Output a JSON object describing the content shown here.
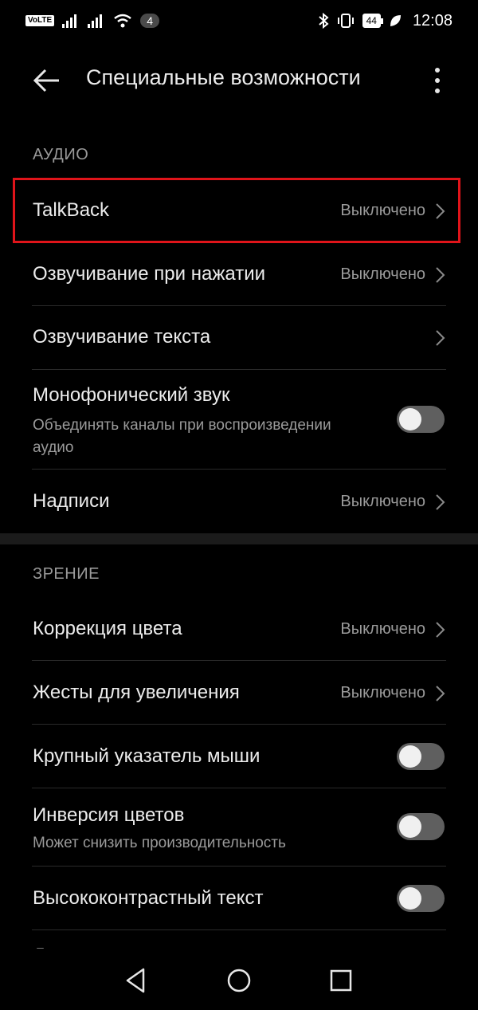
{
  "status_bar": {
    "volte": "VoLTE",
    "notification_count": "4",
    "battery": "44",
    "time": "12:08"
  },
  "header": {
    "title": "Специальные возможности"
  },
  "sections": {
    "audio": {
      "label": "АУДИО",
      "items": [
        {
          "title": "TalkBack",
          "value": "Выключено"
        },
        {
          "title": "Озвучивание при нажатии",
          "value": "Выключено"
        },
        {
          "title": "Озвучивание текста"
        },
        {
          "title": "Монофонический звук",
          "subtitle": "Объединять каналы при воспроизведении аудио",
          "toggle": "off"
        },
        {
          "title": "Надписи",
          "value": "Выключено"
        }
      ]
    },
    "vision": {
      "label": "ЗРЕНИЕ",
      "items": [
        {
          "title": "Коррекция цвета",
          "value": "Выключено"
        },
        {
          "title": "Жесты для увеличения",
          "value": "Выключено"
        },
        {
          "title": "Крупный указатель мыши",
          "toggle": "off"
        },
        {
          "title": "Инверсия цветов",
          "subtitle": "Может снизить производительность",
          "toggle": "off"
        },
        {
          "title": "Высококонтрастный текст",
          "toggle": "off"
        }
      ]
    }
  },
  "cutoff_text": "Дополнительные визуальные",
  "colors": {
    "background": "#000000",
    "highlight": "#e0141a",
    "toggle_off_track": "#5f5f5f",
    "secondary_text": "#9a9a9a"
  },
  "icons": {
    "back": "arrow-left-icon",
    "more": "more-vertical-icon",
    "chevron": "chevron-right-icon",
    "nav_back": "triangle-back-icon",
    "nav_home": "circle-home-icon",
    "nav_recents": "square-recents-icon"
  }
}
